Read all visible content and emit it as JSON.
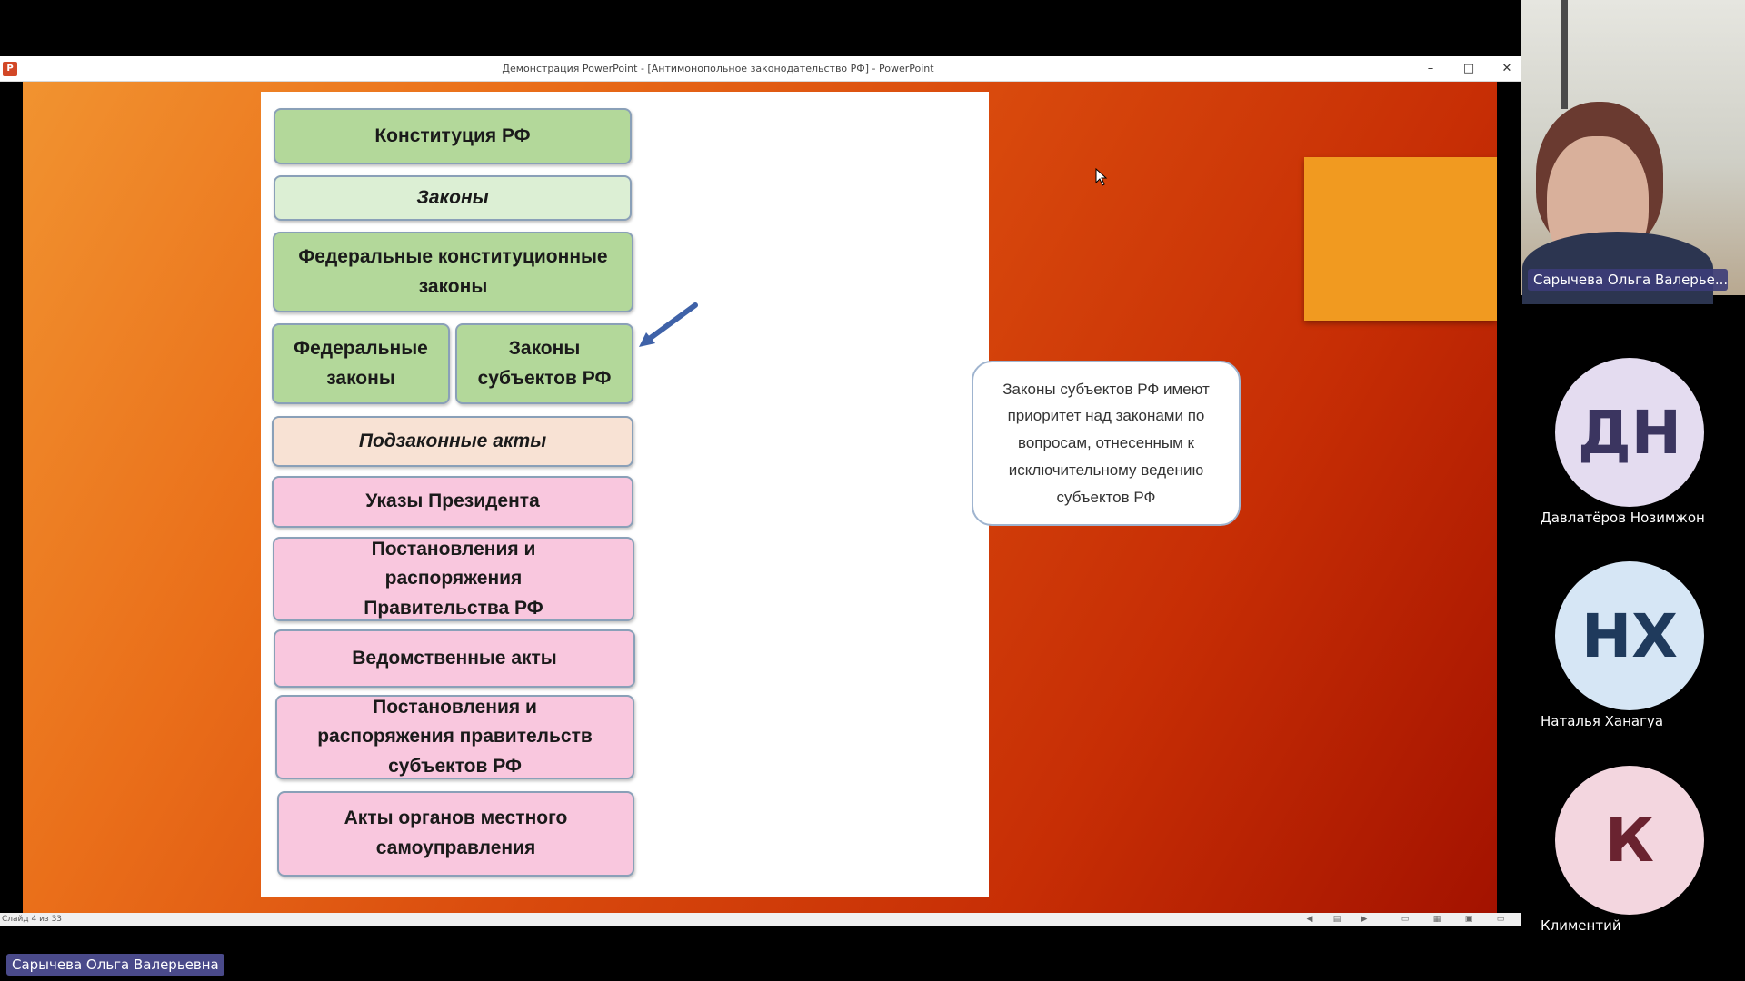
{
  "window": {
    "app_icon": "P",
    "title": "Демонстрация PowerPoint - [Антимонопольное законодательство РФ] - PowerPoint",
    "minimize": "–",
    "maximize": "□",
    "close": "✕"
  },
  "slide": {
    "boxes": [
      "Конституция РФ",
      "Законы",
      "Федеральные конституционные законы",
      "Федеральные законы",
      "Законы субъектов РФ",
      "Подзаконные акты",
      "Указы Президента",
      "Постановления и распоряжения Правительства РФ",
      "Ведомственные акты",
      "Постановления и распоряжения правительств субъектов РФ",
      "Акты органов местного самоуправления"
    ],
    "callout": "Законы субъектов РФ имеют приоритет над законами по вопросам, отнесенным к исключительному ведению субъектов РФ"
  },
  "status_bar": {
    "slide_counter": "Слайд 4 из 33"
  },
  "presenter": {
    "name": "Сарычева Ольга Валерьевна"
  },
  "participants": {
    "video": {
      "name": "Сарычева Ольга Валерье..."
    },
    "list": [
      {
        "initials": "ДН",
        "name": "Давлатёров Нозимжон",
        "bg": "#e4dcf0",
        "fg": "#3b3560"
      },
      {
        "initials": "НХ",
        "name": "Наталья Ханагуа",
        "bg": "#d6e6f5",
        "fg": "#1f3a5c"
      },
      {
        "initials": "К",
        "name": "Климентий",
        "bg": "#f3d6df",
        "fg": "#6a2330"
      }
    ]
  },
  "colors": {
    "box_green": "#b3d89a",
    "box_light_green": "#dcefd4",
    "box_peach": "#f8e2d4",
    "box_pink": "#f9c7de",
    "deco_orange": "#f19a20"
  }
}
